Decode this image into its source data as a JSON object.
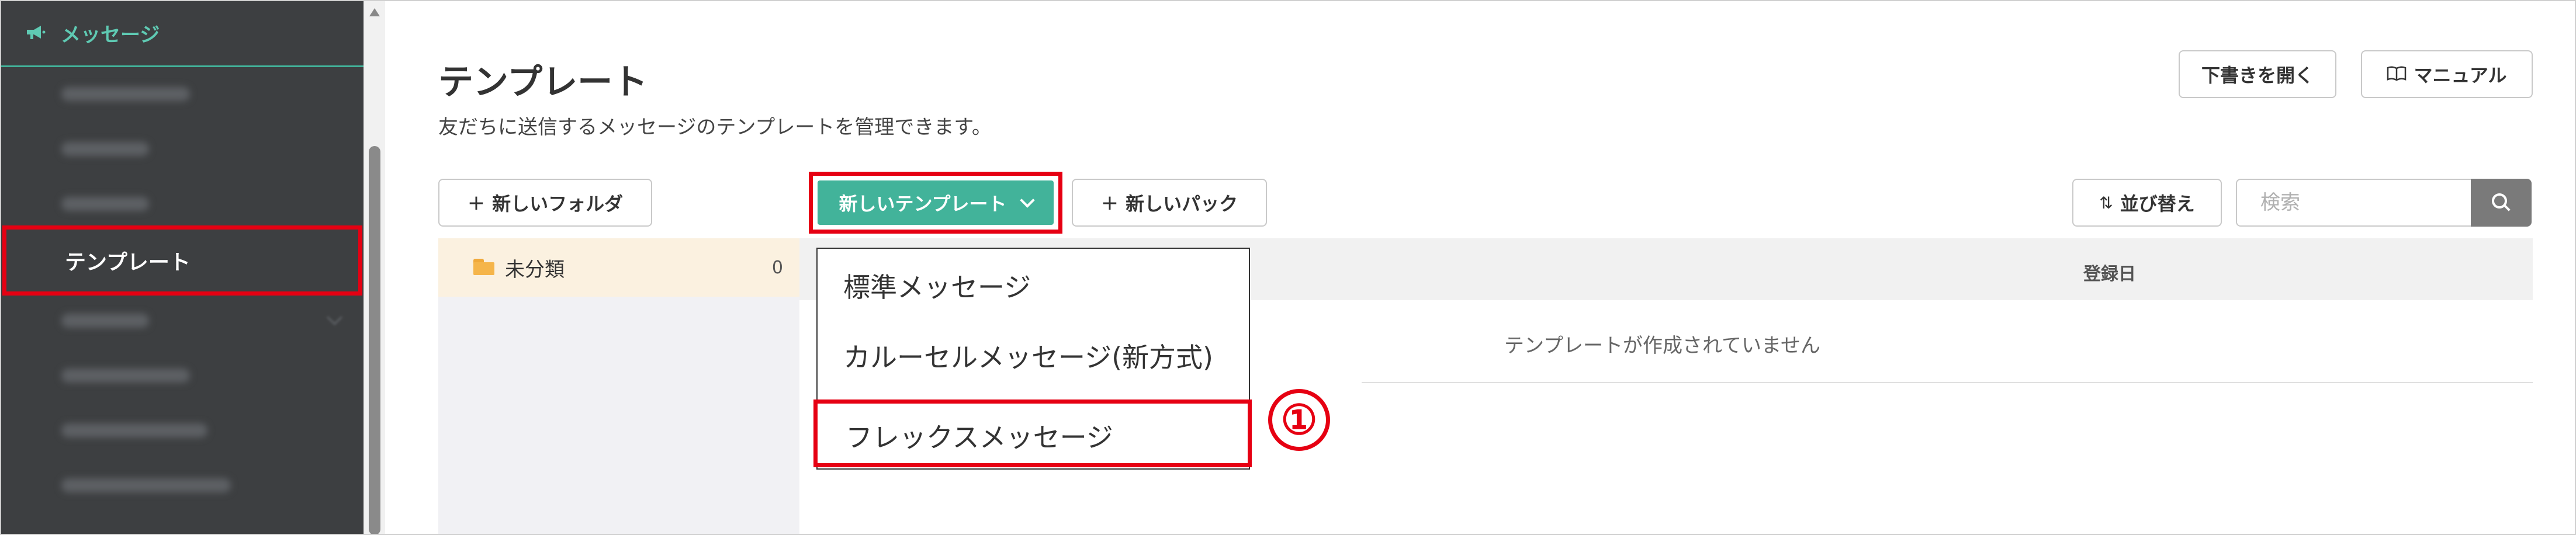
{
  "sidebar": {
    "header_icon": "megaphone-icon",
    "header_label": "メッセージ",
    "active_item": "テンプレート",
    "accent_color": "#42b39a",
    "highlight_color": "#e60012"
  },
  "header": {
    "title": "テンプレート",
    "description": "友だちに送信するメッセージのテンプレートを管理できます。",
    "draft_button": "下書きを開く",
    "manual_button": "マニュアル",
    "manual_icon": "book-icon"
  },
  "toolbar": {
    "new_folder": "新しいフォルダ",
    "new_template": "新しいテンプレート",
    "new_pack": "新しいパック",
    "sort": "並び替え",
    "sort_icon": "sort-icon",
    "search_placeholder": "検索",
    "search_icon": "search-icon"
  },
  "folders": [
    {
      "name": "未分類",
      "count": "0",
      "icon": "folder-icon"
    }
  ],
  "table": {
    "column_date": "登録日",
    "empty_message": "テンプレートが作成されていません"
  },
  "dropdown": {
    "items": [
      "標準メッセージ",
      "カルーセルメッセージ(新方式)",
      "フレックスメッセージ"
    ]
  },
  "annotation": {
    "marker": "①"
  }
}
